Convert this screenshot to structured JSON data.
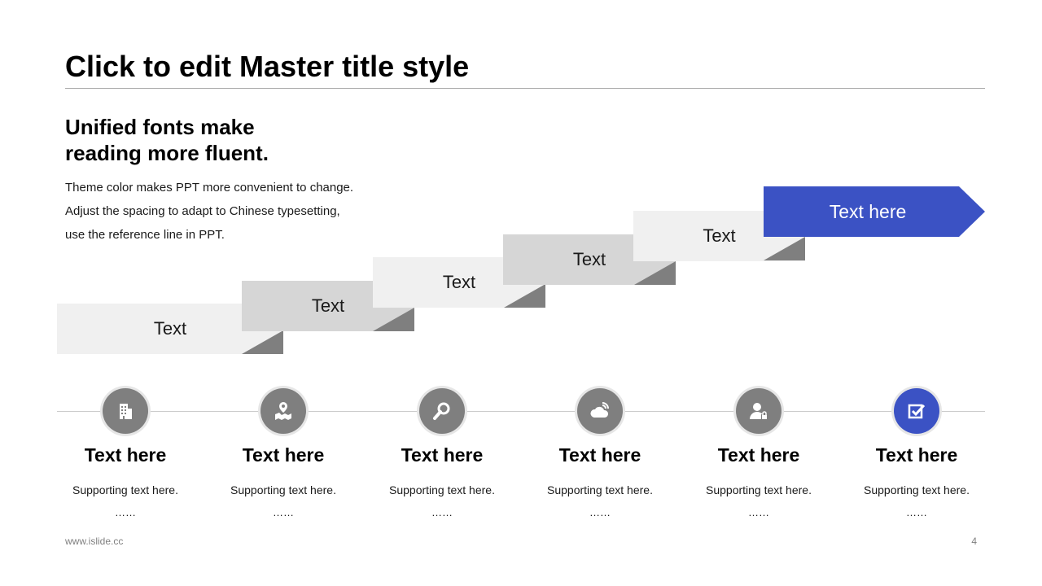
{
  "slide": {
    "title": "Click to edit Master title style",
    "subheading": [
      "Unified fonts make",
      "reading more fluent."
    ],
    "body_lines": [
      "Theme color makes PPT more convenient to change.",
      "Adjust the spacing to adapt to Chinese typesetting,",
      "use the reference line in PPT."
    ]
  },
  "steps": [
    "Text",
    "Text",
    "Text",
    "Text",
    "Text"
  ],
  "final_step": "Text here",
  "columns": [
    {
      "icon": "building-icon",
      "title": "Text here",
      "support": "Supporting text here.",
      "ellipsis": "……"
    },
    {
      "icon": "map-pin-icon",
      "title": "Text here",
      "support": "Supporting text here.",
      "ellipsis": "……"
    },
    {
      "icon": "search-icon",
      "title": "Text here",
      "support": "Supporting text here.",
      "ellipsis": "……"
    },
    {
      "icon": "cloud-signal-icon",
      "title": "Text here",
      "support": "Supporting text here.",
      "ellipsis": "……"
    },
    {
      "icon": "user-lock-icon",
      "title": "Text here",
      "support": "Supporting text here.",
      "ellipsis": "……"
    },
    {
      "icon": "checkbox-icon",
      "title": "Text here",
      "support": "Supporting text here.",
      "ellipsis": "……"
    }
  ],
  "footer": {
    "url": "www.islide.cc",
    "page": "4"
  },
  "colors": {
    "accent": "#3b52c4",
    "icon_gray": "#7f7f7f",
    "step_light": "#f0f0f0",
    "step_mid": "#d6d6d6",
    "fold": "#7f7f7f"
  }
}
